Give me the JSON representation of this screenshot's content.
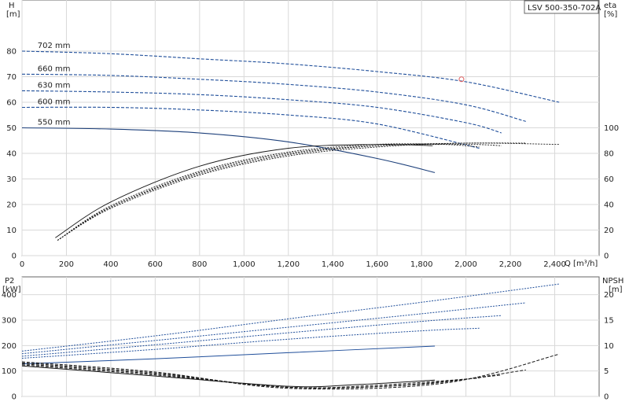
{
  "chart_data": [
    {
      "type": "line",
      "title": "LSV 500-350-702A",
      "xlabel": "Q [m³/h]",
      "ylabel_left": [
        "H",
        "[m]"
      ],
      "ylabel_right": [
        "eta",
        "[%]"
      ],
      "xlim": [
        0,
        2600
      ],
      "ylim_left": [
        0,
        100
      ],
      "ylim_right_ticks": [
        0,
        20,
        40,
        60,
        80,
        100
      ],
      "x_ticks": [
        "0",
        "200",
        "400",
        "600",
        "800",
        "1,000",
        "1,200",
        "1,400",
        "1,600",
        "1,800",
        "2,000",
        "2,200",
        "2,400"
      ],
      "y_ticks_left": [
        0,
        10,
        20,
        30,
        40,
        50,
        60,
        70,
        80
      ],
      "grid": true,
      "colors": {
        "blue": "#1f4e9a",
        "dark": "#1a1a1a",
        "operating_point": "#e06060"
      },
      "operating_point": {
        "q": 1980,
        "h": 69
      },
      "series": [
        {
          "name": "702 mm",
          "x": [
            0,
            400,
            800,
            1200,
            1600,
            2000,
            2420
          ],
          "y": [
            80,
            79,
            77,
            75,
            72,
            68,
            60
          ]
        },
        {
          "name": "660 mm",
          "x": [
            0,
            400,
            800,
            1200,
            1600,
            2000,
            2270
          ],
          "y": [
            71,
            70.5,
            69,
            67,
            64,
            59,
            52.5
          ]
        },
        {
          "name": "630 mm",
          "x": [
            0,
            400,
            800,
            1200,
            1600,
            2000,
            2160
          ],
          "y": [
            64.5,
            64,
            63,
            61,
            58,
            52,
            48
          ]
        },
        {
          "name": "600 mm",
          "x": [
            0,
            400,
            800,
            1200,
            1600,
            2060
          ],
          "y": [
            58,
            58,
            57,
            55,
            51.5,
            42
          ]
        },
        {
          "name": "550 mm",
          "x": [
            0,
            400,
            800,
            1200,
            1600,
            1860
          ],
          "y": [
            50,
            49.5,
            48,
            44.5,
            38,
            32.5
          ]
        }
      ],
      "efficiency_series": [
        {
          "x": [
            150,
            400,
            800,
            1200,
            1600,
            1850
          ],
          "y": [
            14,
            42,
            70,
            84,
            87,
            86
          ]
        },
        {
          "x": [
            160,
            400,
            800,
            1200,
            1600,
            1900,
            2060
          ],
          "y": [
            12,
            39,
            66,
            81,
            87,
            87,
            85
          ]
        },
        {
          "x": [
            160,
            400,
            800,
            1200,
            1600,
            2000,
            2160
          ],
          "y": [
            12,
            38,
            65,
            80,
            86,
            87,
            86
          ]
        },
        {
          "x": [
            160,
            400,
            800,
            1200,
            1600,
            2000,
            2270
          ],
          "y": [
            12,
            38,
            64,
            79,
            86,
            88,
            88
          ]
        },
        {
          "x": [
            160,
            400,
            800,
            1200,
            1600,
            2000,
            2420
          ],
          "y": [
            12,
            37,
            63,
            78,
            85,
            88,
            87
          ]
        }
      ]
    },
    {
      "type": "line",
      "xlim": [
        0,
        2600
      ],
      "ylabel_left": [
        "P2",
        "[kW]"
      ],
      "ylabel_right": [
        "NPSH",
        "[m]"
      ],
      "y_ticks_left": [
        0,
        100,
        200,
        300,
        400
      ],
      "y_ticks_right": [
        0,
        5,
        10,
        15,
        20
      ],
      "ylim_left": [
        0,
        470
      ],
      "ylim_right": [
        0,
        23.5
      ],
      "grid": true,
      "power_series": [
        {
          "x": [
            0,
            600,
            1200,
            1860
          ],
          "y": [
            128,
            148,
            172,
            198
          ]
        },
        {
          "x": [
            0,
            600,
            1200,
            1800,
            2060
          ],
          "y": [
            150,
            185,
            225,
            258,
            268
          ]
        },
        {
          "x": [
            0,
            600,
            1200,
            1800,
            2160
          ],
          "y": [
            158,
            203,
            250,
            295,
            318
          ]
        },
        {
          "x": [
            0,
            600,
            1200,
            1800,
            2270
          ],
          "y": [
            168,
            220,
            272,
            325,
            368
          ]
        },
        {
          "x": [
            0,
            600,
            1200,
            1800,
            2420
          ],
          "y": [
            178,
            238,
            305,
            370,
            442
          ]
        }
      ],
      "npsh_series": [
        {
          "x": [
            0,
            600,
            1200,
            1500,
            1860
          ],
          "y": [
            6,
            4,
            2,
            2.3,
            3.2
          ]
        },
        {
          "x": [
            0,
            600,
            1200,
            1600,
            2060
          ],
          "y": [
            6.2,
            4.2,
            1.8,
            2.2,
            3.6
          ]
        },
        {
          "x": [
            0,
            600,
            1200,
            1700,
            2160
          ],
          "y": [
            6.4,
            4.4,
            1.8,
            2.2,
            4.2
          ]
        },
        {
          "x": [
            0,
            600,
            1200,
            1800,
            2270
          ],
          "y": [
            6.6,
            4.6,
            1.8,
            2.4,
            5.2
          ]
        },
        {
          "x": [
            0,
            600,
            1200,
            1900,
            2420
          ],
          "y": [
            6.8,
            4.8,
            1.6,
            2.6,
            8.3
          ]
        }
      ]
    }
  ]
}
